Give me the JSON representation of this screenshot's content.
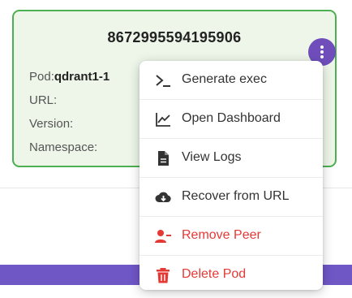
{
  "card": {
    "title": "8672995594195906",
    "fields": [
      {
        "label": "Pod:",
        "value": "qdrant1-1"
      },
      {
        "label": "URL:",
        "value": ""
      },
      {
        "label": "Version:",
        "value": ""
      },
      {
        "label": "Namespace:",
        "value": ""
      }
    ],
    "more_icon": "more-vertical-icon"
  },
  "menu": {
    "items": [
      {
        "label": "Generate exec",
        "icon": "terminal-icon",
        "danger": false
      },
      {
        "label": "Open Dashboard",
        "icon": "chart-line-icon",
        "danger": false
      },
      {
        "label": "View Logs",
        "icon": "document-icon",
        "danger": false
      },
      {
        "label": "Recover from URL",
        "icon": "cloud-download-icon",
        "danger": false
      },
      {
        "label": "Remove Peer",
        "icon": "user-remove-icon",
        "danger": true
      },
      {
        "label": "Delete Pod",
        "icon": "trash-icon",
        "danger": true
      }
    ]
  },
  "colors": {
    "card_bg": "#edf6e9",
    "card_border": "#4caf50",
    "accent": "#6f4ebc",
    "danger": "#e53935",
    "bar": "#6f57c6"
  }
}
